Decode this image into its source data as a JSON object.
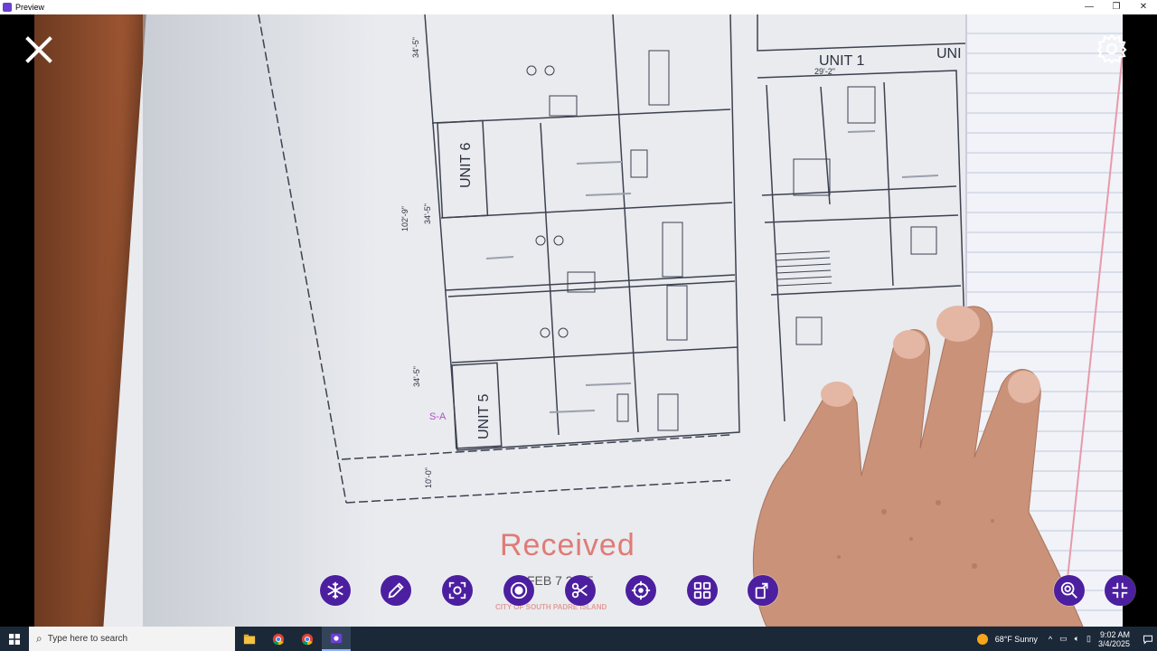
{
  "window": {
    "title": "Preview",
    "minimize": "—",
    "restore": "❐",
    "close": "✕"
  },
  "document": {
    "unit_labels": [
      "UNIT 1",
      "UNIT 6",
      "UNIT 5",
      "UNI"
    ],
    "dimensions": [
      "34'-5\"",
      "102'-9\"",
      "34'-5\"",
      "34'-5\"",
      "10'-0\"",
      "29'-2\""
    ],
    "stamp_received": "Received",
    "stamp_date": "FEB  7 2025",
    "stamp_agency": "CITY OF SOUTH PADRE ISLAND"
  },
  "toolbar": {
    "tools": [
      "freeze",
      "pen",
      "screenshot",
      "record",
      "cut",
      "crosshair",
      "grid",
      "rotate"
    ]
  },
  "taskbar": {
    "search_placeholder": "Type here to search",
    "weather": "68°F  Sunny",
    "time": "9:02 AM",
    "date": "3/4/2025"
  },
  "colors": {
    "accent": "#4c1fa0",
    "stamp": "#e07b76",
    "taskbar": "#1b2838"
  }
}
